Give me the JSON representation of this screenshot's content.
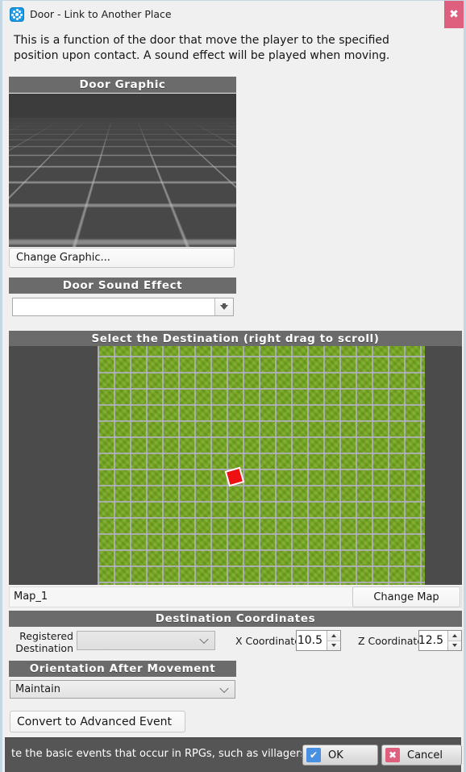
{
  "window": {
    "title": "Door - Link to Another Place",
    "icon": "app-icon",
    "close_label": "✖"
  },
  "description": "This is a function of the door that move the player to the specified position upon contact. A sound effect will be played when moving.",
  "sections": {
    "door_graphic": {
      "header": "Door Graphic",
      "change_button": "Change Graphic..."
    },
    "door_sound_effect": {
      "header": "Door Sound Effect",
      "value": "",
      "placeholder": ""
    },
    "destination": {
      "header": "Select the Destination (right drag to scroll)",
      "map_name": "Map_1",
      "change_map_button": "Change Map"
    },
    "coordinates": {
      "header": "Destination Coordinates",
      "registered_destination_label_line1": "Registered",
      "registered_destination_label_line2": "Destination",
      "registered_destination_value": "",
      "x_label": "X Coordinate",
      "x_value": "10.5",
      "z_label": "Z Coordinate",
      "z_value": "12.5"
    },
    "orientation": {
      "header": "Orientation After Movement",
      "value": "Maintain"
    }
  },
  "convert_button": "Convert to Advanced Event",
  "bottom": {
    "hint_text": "te the basic events that occur in RPGs, such as villagers",
    "ok_label": "OK",
    "cancel_label": "Cancel",
    "ok_glyph": "✔",
    "cancel_glyph": "✖"
  },
  "colors": {
    "accent_blue": "#1b9ae8",
    "close_pink": "#df5f7f",
    "header_gray": "#6b6b6b",
    "map_green": "#74a81f",
    "marker_red": "#ee1111",
    "ok_blue": "#4a90e2"
  }
}
